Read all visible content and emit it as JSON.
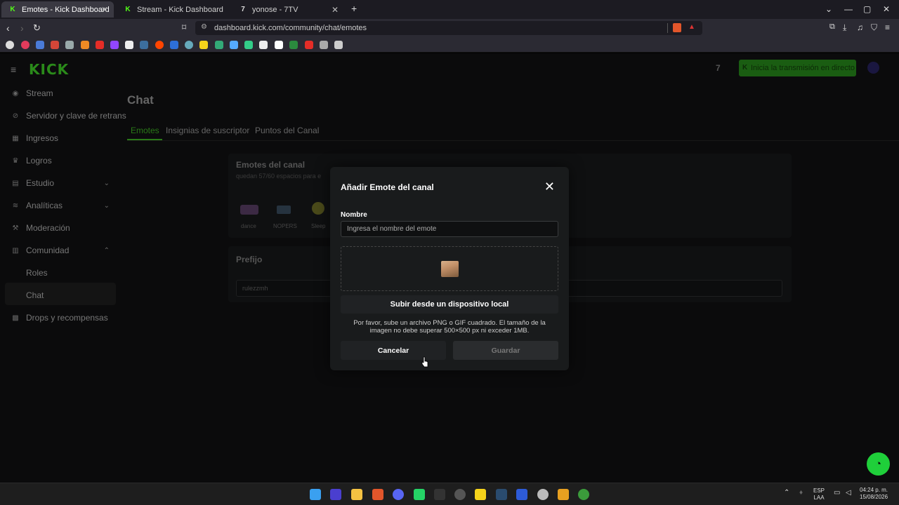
{
  "browser": {
    "tabs": [
      {
        "title": "Emotes - Kick Dashboard",
        "active": true
      },
      {
        "title": "Stream - Kick Dashboard",
        "active": false
      },
      {
        "title": "yonose - 7TV",
        "active": false
      }
    ],
    "new_tab": "+",
    "url": "dashboard.kick.com/community/chat/emotes"
  },
  "app": {
    "logo": "KICK",
    "launch_button": "Inicia la transmisión en directo",
    "sidebar": [
      {
        "label": "Stream",
        "icon": "broadcast-icon"
      },
      {
        "label": "Servidor y clave de retrans",
        "icon": "key-icon"
      },
      {
        "label": "Ingresos",
        "icon": "dollar-icon"
      },
      {
        "label": "Logros",
        "icon": "trophy-icon"
      },
      {
        "label": "Estudio",
        "icon": "studio-icon"
      },
      {
        "label": "Analíticas",
        "icon": "chart-icon"
      },
      {
        "label": "Moderación",
        "icon": "shield-icon"
      },
      {
        "label": "Comunidad",
        "icon": "community-icon"
      },
      {
        "label": "Drops y recompensas",
        "icon": "gift-icon"
      }
    ],
    "sidebar_sub": [
      "Roles",
      "Chat"
    ],
    "page_title": "Chat",
    "page_tabs": [
      "Emotes",
      "Insignias de suscriptor",
      "Puntos del Canal"
    ],
    "emotes_card": {
      "title": "Emotes del canal",
      "subtitle": "quedan 57/60 espacios para e",
      "emotes": [
        "dance",
        "NOPERS",
        "Sleep"
      ]
    },
    "prefix_card": {
      "title": "Prefijo",
      "value": "rulezzmh"
    }
  },
  "modal": {
    "title": "Añadir Emote del canal",
    "name_label": "Nombre",
    "name_placeholder": "Ingresa el nombre del emote",
    "upload_button": "Subir desde un dispositivo local",
    "help_line1": "Por favor, sube un archivo PNG o GIF cuadrado. El tamaño de la",
    "help_line2": "imagen no debe superar 500×500 px ni exceder 1MB.",
    "cancel": "Cancelar",
    "save": "Guardar"
  },
  "taskbar": {
    "lang1": "ESP",
    "lang2": "LAA",
    "time": "04:24 p. m.",
    "date": "15/08/2026"
  },
  "colors": {
    "accent": "#53fc18",
    "modal_bg": "#191b1c",
    "help_bubble": "#1fcf3a"
  }
}
